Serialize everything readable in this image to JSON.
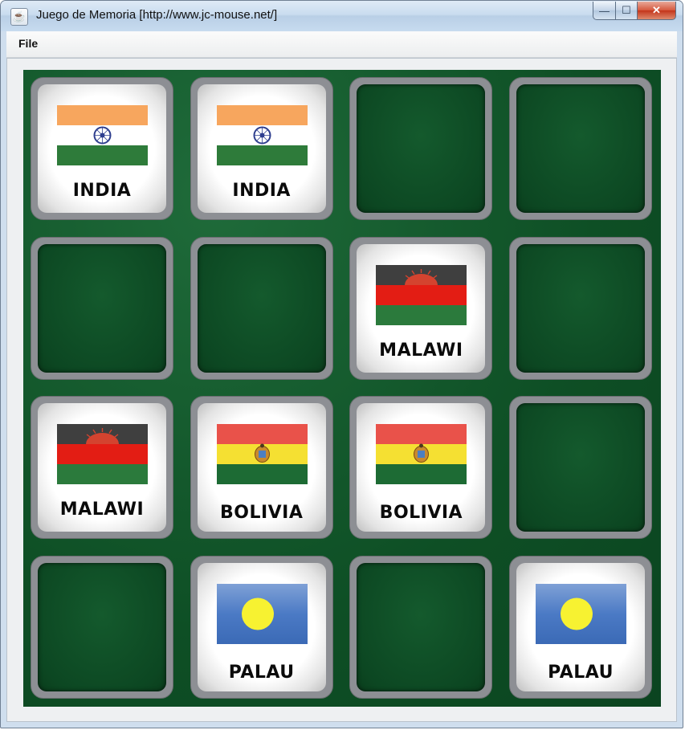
{
  "window": {
    "title": "Juego de Memoria [http://www.jc-mouse.net/]",
    "controls": {
      "minimize": "—",
      "maximize": "☐",
      "close": "✕"
    }
  },
  "menu": {
    "file": "File"
  },
  "colors": {
    "board": "#0e4f25",
    "card_frame": "#8d8f94"
  },
  "board": {
    "rows": 4,
    "cols": 4,
    "cards": [
      {
        "state": "up",
        "country": "INDIA",
        "flag": "india"
      },
      {
        "state": "up",
        "country": "INDIA",
        "flag": "india"
      },
      {
        "state": "down"
      },
      {
        "state": "down"
      },
      {
        "state": "down"
      },
      {
        "state": "down"
      },
      {
        "state": "up",
        "country": "MALAWI",
        "flag": "malawi"
      },
      {
        "state": "down"
      },
      {
        "state": "up",
        "country": "MALAWI",
        "flag": "malawi"
      },
      {
        "state": "up",
        "country": "BOLIVIA",
        "flag": "bolivia"
      },
      {
        "state": "up",
        "country": "BOLIVIA",
        "flag": "bolivia"
      },
      {
        "state": "down"
      },
      {
        "state": "down"
      },
      {
        "state": "up",
        "country": "PALAU",
        "flag": "palau"
      },
      {
        "state": "down"
      },
      {
        "state": "up",
        "country": "PALAU",
        "flag": "palau"
      }
    ]
  }
}
